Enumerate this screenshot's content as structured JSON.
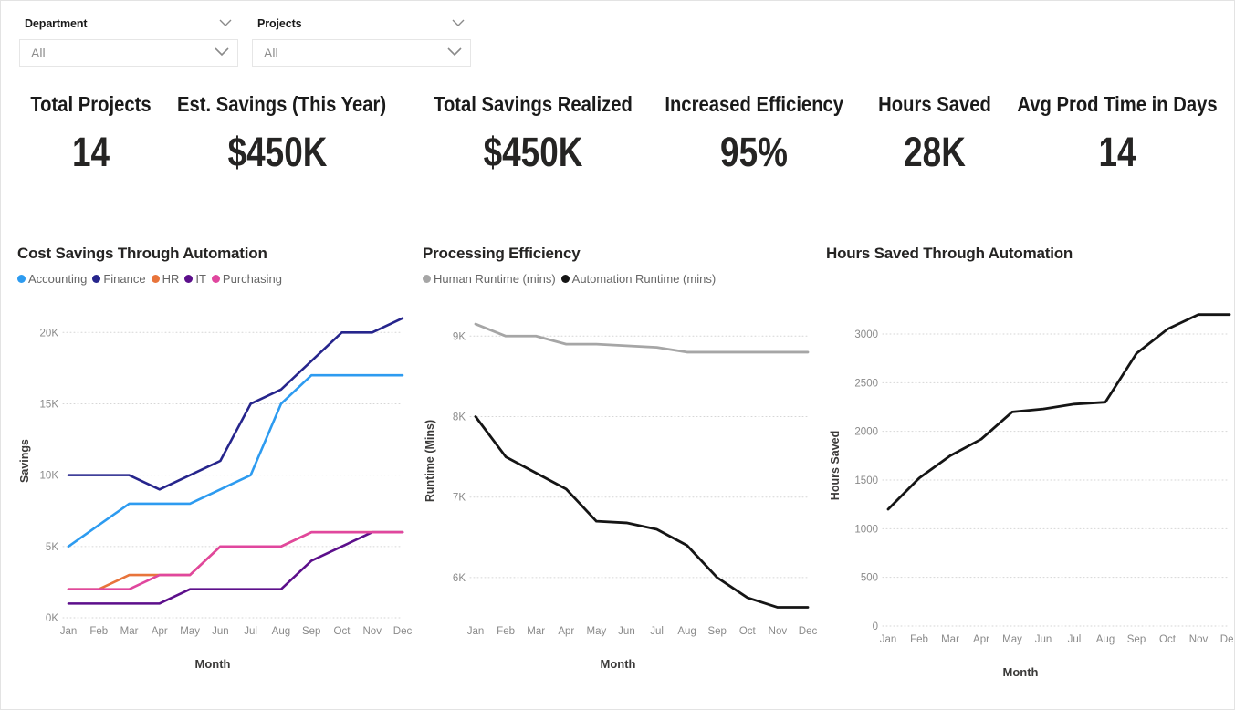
{
  "slicers": [
    {
      "name": "department",
      "title": "Department",
      "value": "All",
      "icon": "chevron-down-icon"
    },
    {
      "name": "projects",
      "title": "Projects",
      "value": "All",
      "icon": "chevron-down-icon"
    }
  ],
  "kpis": [
    {
      "label": "Total Projects",
      "value": "14"
    },
    {
      "label": "Est. Savings (This Year)",
      "value": "$450K"
    },
    {
      "label": "Total Savings Realized",
      "value": "$450K"
    },
    {
      "label": "Increased Efficiency",
      "value": "95%"
    },
    {
      "label": "Hours Saved",
      "value": "28K"
    },
    {
      "label": "Avg Prod Time in Days",
      "value": "14"
    }
  ],
  "colors": {
    "accounting": "#2D9BF0",
    "finance": "#26258C",
    "hr": "#E8743B",
    "it": "#5C0F8B",
    "purchasing": "#E0479E",
    "human": "#A6A6A6",
    "automation": "#151515",
    "grid": "#d6d6d6",
    "axis_text": "#8a8a8a",
    "title": "#252423"
  },
  "chart_data": [
    {
      "type": "line",
      "title": "Cost Savings Through Automation",
      "xlabel": "Month",
      "ylabel": "Savings",
      "categories": [
        "Jan",
        "Feb",
        "Mar",
        "Apr",
        "May",
        "Jun",
        "Jul",
        "Aug",
        "Sep",
        "Oct",
        "Nov",
        "Dec"
      ],
      "ylim": [
        0,
        22000
      ],
      "yticks": [
        0,
        5000,
        10000,
        15000,
        20000
      ],
      "ytick_labels": [
        "0K",
        "5K",
        "10K",
        "15K",
        "20K"
      ],
      "grid": true,
      "legend_position": "top-left",
      "series": [
        {
          "name": "Accounting",
          "color": "#2D9BF0",
          "values": [
            5000,
            6500,
            8000,
            8000,
            8000,
            9000,
            10000,
            15000,
            17000,
            17000,
            17000,
            17000
          ]
        },
        {
          "name": "Finance",
          "color": "#26258C",
          "values": [
            10000,
            10000,
            10000,
            9000,
            10000,
            11000,
            15000,
            16000,
            18000,
            20000,
            20000,
            21000
          ]
        },
        {
          "name": "HR",
          "color": "#E8743B",
          "values": [
            2000,
            2000,
            3000,
            3000,
            3000,
            5000,
            5000,
            5000,
            6000,
            6000,
            6000,
            6000
          ]
        },
        {
          "name": "IT",
          "color": "#5C0F8B",
          "values": [
            1000,
            1000,
            1000,
            1000,
            2000,
            2000,
            2000,
            2000,
            4000,
            5000,
            6000,
            6000
          ]
        },
        {
          "name": "Purchasing",
          "color": "#E0479E",
          "values": [
            2000,
            2000,
            2000,
            3000,
            3000,
            5000,
            5000,
            5000,
            6000,
            6000,
            6000,
            6000
          ]
        }
      ]
    },
    {
      "type": "line",
      "title": "Processing Efficiency",
      "xlabel": "Month",
      "ylabel": "Runtime (Mins)",
      "categories": [
        "Jan",
        "Feb",
        "Mar",
        "Apr",
        "May",
        "Jun",
        "Jul",
        "Aug",
        "Sep",
        "Oct",
        "Nov",
        "Dec"
      ],
      "ylim": [
        5500,
        9400
      ],
      "yticks": [
        6000,
        7000,
        8000,
        9000
      ],
      "ytick_labels": [
        "6K",
        "7K",
        "8K",
        "9K"
      ],
      "grid": true,
      "legend_position": "top-left",
      "series": [
        {
          "name": "Human Runtime (mins)",
          "color": "#A6A6A6",
          "values": [
            9150,
            9000,
            9000,
            8900,
            8900,
            8880,
            8860,
            8800,
            8800,
            8800,
            8800,
            8800
          ]
        },
        {
          "name": "Automation Runtime (mins)",
          "color": "#151515",
          "values": [
            8000,
            7500,
            7300,
            7100,
            6700,
            6680,
            6600,
            6400,
            6000,
            5750,
            5630,
            5630
          ]
        }
      ]
    },
    {
      "type": "line",
      "title": "Hours Saved Through Automation",
      "xlabel": "Month",
      "ylabel": "Hours Saved",
      "categories": [
        "Jan",
        "Feb",
        "Mar",
        "Apr",
        "May",
        "Jun",
        "Jul",
        "Aug",
        "Sep",
        "Oct",
        "Nov",
        "Dec"
      ],
      "ylim": [
        0,
        3300
      ],
      "yticks": [
        0,
        500,
        1000,
        1500,
        2000,
        2500,
        3000
      ],
      "ytick_labels": [
        "0",
        "500",
        "1000",
        "1500",
        "2000",
        "2500",
        "3000"
      ],
      "grid": false,
      "legend_position": "none",
      "series": [
        {
          "name": "Hours Saved",
          "color": "#151515",
          "values": [
            1200,
            1520,
            1750,
            1920,
            2200,
            2230,
            2280,
            2300,
            2800,
            3050,
            3200,
            3200
          ]
        }
      ]
    }
  ]
}
